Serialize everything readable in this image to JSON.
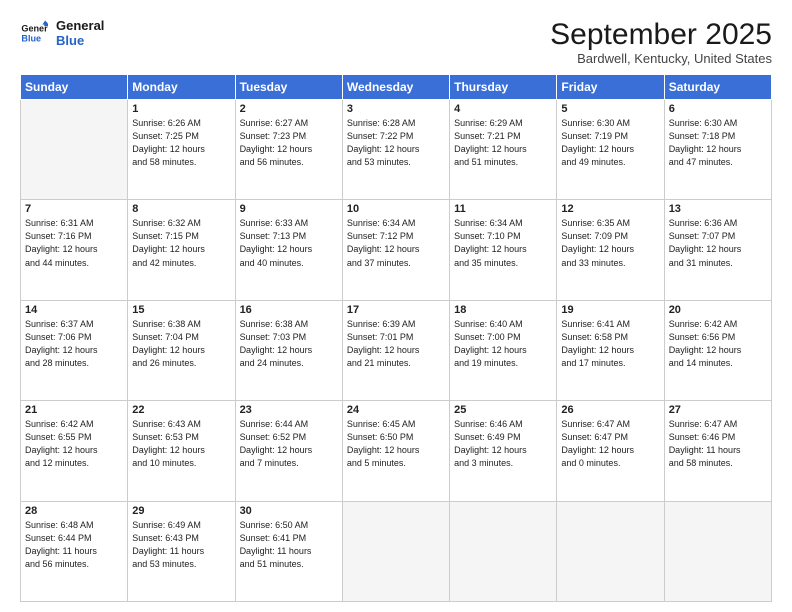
{
  "header": {
    "logo_line1": "General",
    "logo_line2": "Blue",
    "month": "September 2025",
    "location": "Bardwell, Kentucky, United States"
  },
  "days_of_week": [
    "Sunday",
    "Monday",
    "Tuesday",
    "Wednesday",
    "Thursday",
    "Friday",
    "Saturday"
  ],
  "weeks": [
    [
      {
        "day": "",
        "detail": ""
      },
      {
        "day": "1",
        "detail": "Sunrise: 6:26 AM\nSunset: 7:25 PM\nDaylight: 12 hours\nand 58 minutes."
      },
      {
        "day": "2",
        "detail": "Sunrise: 6:27 AM\nSunset: 7:23 PM\nDaylight: 12 hours\nand 56 minutes."
      },
      {
        "day": "3",
        "detail": "Sunrise: 6:28 AM\nSunset: 7:22 PM\nDaylight: 12 hours\nand 53 minutes."
      },
      {
        "day": "4",
        "detail": "Sunrise: 6:29 AM\nSunset: 7:21 PM\nDaylight: 12 hours\nand 51 minutes."
      },
      {
        "day": "5",
        "detail": "Sunrise: 6:30 AM\nSunset: 7:19 PM\nDaylight: 12 hours\nand 49 minutes."
      },
      {
        "day": "6",
        "detail": "Sunrise: 6:30 AM\nSunset: 7:18 PM\nDaylight: 12 hours\nand 47 minutes."
      }
    ],
    [
      {
        "day": "7",
        "detail": "Sunrise: 6:31 AM\nSunset: 7:16 PM\nDaylight: 12 hours\nand 44 minutes."
      },
      {
        "day": "8",
        "detail": "Sunrise: 6:32 AM\nSunset: 7:15 PM\nDaylight: 12 hours\nand 42 minutes."
      },
      {
        "day": "9",
        "detail": "Sunrise: 6:33 AM\nSunset: 7:13 PM\nDaylight: 12 hours\nand 40 minutes."
      },
      {
        "day": "10",
        "detail": "Sunrise: 6:34 AM\nSunset: 7:12 PM\nDaylight: 12 hours\nand 37 minutes."
      },
      {
        "day": "11",
        "detail": "Sunrise: 6:34 AM\nSunset: 7:10 PM\nDaylight: 12 hours\nand 35 minutes."
      },
      {
        "day": "12",
        "detail": "Sunrise: 6:35 AM\nSunset: 7:09 PM\nDaylight: 12 hours\nand 33 minutes."
      },
      {
        "day": "13",
        "detail": "Sunrise: 6:36 AM\nSunset: 7:07 PM\nDaylight: 12 hours\nand 31 minutes."
      }
    ],
    [
      {
        "day": "14",
        "detail": "Sunrise: 6:37 AM\nSunset: 7:06 PM\nDaylight: 12 hours\nand 28 minutes."
      },
      {
        "day": "15",
        "detail": "Sunrise: 6:38 AM\nSunset: 7:04 PM\nDaylight: 12 hours\nand 26 minutes."
      },
      {
        "day": "16",
        "detail": "Sunrise: 6:38 AM\nSunset: 7:03 PM\nDaylight: 12 hours\nand 24 minutes."
      },
      {
        "day": "17",
        "detail": "Sunrise: 6:39 AM\nSunset: 7:01 PM\nDaylight: 12 hours\nand 21 minutes."
      },
      {
        "day": "18",
        "detail": "Sunrise: 6:40 AM\nSunset: 7:00 PM\nDaylight: 12 hours\nand 19 minutes."
      },
      {
        "day": "19",
        "detail": "Sunrise: 6:41 AM\nSunset: 6:58 PM\nDaylight: 12 hours\nand 17 minutes."
      },
      {
        "day": "20",
        "detail": "Sunrise: 6:42 AM\nSunset: 6:56 PM\nDaylight: 12 hours\nand 14 minutes."
      }
    ],
    [
      {
        "day": "21",
        "detail": "Sunrise: 6:42 AM\nSunset: 6:55 PM\nDaylight: 12 hours\nand 12 minutes."
      },
      {
        "day": "22",
        "detail": "Sunrise: 6:43 AM\nSunset: 6:53 PM\nDaylight: 12 hours\nand 10 minutes."
      },
      {
        "day": "23",
        "detail": "Sunrise: 6:44 AM\nSunset: 6:52 PM\nDaylight: 12 hours\nand 7 minutes."
      },
      {
        "day": "24",
        "detail": "Sunrise: 6:45 AM\nSunset: 6:50 PM\nDaylight: 12 hours\nand 5 minutes."
      },
      {
        "day": "25",
        "detail": "Sunrise: 6:46 AM\nSunset: 6:49 PM\nDaylight: 12 hours\nand 3 minutes."
      },
      {
        "day": "26",
        "detail": "Sunrise: 6:47 AM\nSunset: 6:47 PM\nDaylight: 12 hours\nand 0 minutes."
      },
      {
        "day": "27",
        "detail": "Sunrise: 6:47 AM\nSunset: 6:46 PM\nDaylight: 11 hours\nand 58 minutes."
      }
    ],
    [
      {
        "day": "28",
        "detail": "Sunrise: 6:48 AM\nSunset: 6:44 PM\nDaylight: 11 hours\nand 56 minutes."
      },
      {
        "day": "29",
        "detail": "Sunrise: 6:49 AM\nSunset: 6:43 PM\nDaylight: 11 hours\nand 53 minutes."
      },
      {
        "day": "30",
        "detail": "Sunrise: 6:50 AM\nSunset: 6:41 PM\nDaylight: 11 hours\nand 51 minutes."
      },
      {
        "day": "",
        "detail": ""
      },
      {
        "day": "",
        "detail": ""
      },
      {
        "day": "",
        "detail": ""
      },
      {
        "day": "",
        "detail": ""
      }
    ]
  ]
}
